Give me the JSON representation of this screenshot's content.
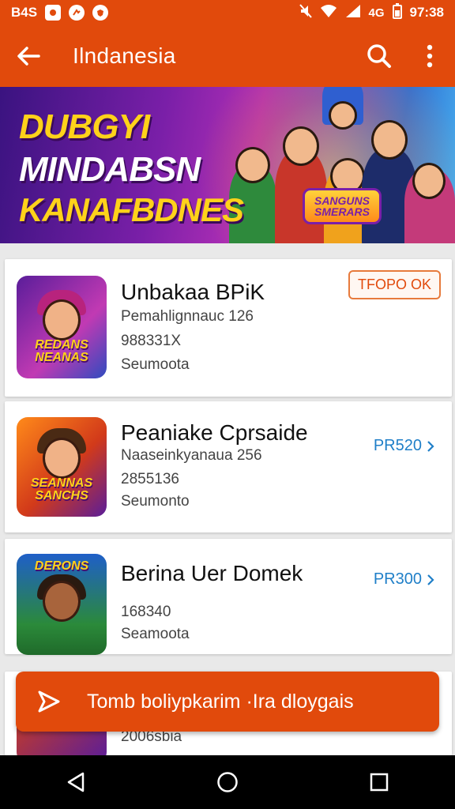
{
  "status_bar": {
    "left_text": "B4S",
    "time": "97:38",
    "left_icons": [
      "image-icon",
      "message-icon",
      "shield-icon"
    ],
    "right_icons": [
      "mute-icon",
      "wifi-icon",
      "signal-icon",
      "data-icon",
      "battery-icon"
    ],
    "data_label": "4G"
  },
  "app_bar": {
    "title": "Ilndanesia",
    "back_icon": "arrow-left-icon",
    "search_icon": "search-icon",
    "more_icon": "more-vert-icon"
  },
  "banner": {
    "line1": "DUBGYI",
    "line2": "MINDABSN",
    "line3": "KANAFBDNES",
    "badge": "SANGUNS SMERARS"
  },
  "items": [
    {
      "title": "Unbakaa BPiK",
      "line1": "Pemahlignnauc 126",
      "line2": "988331X",
      "line3": "Seumoota",
      "tag": "TFOPO OK",
      "price": "",
      "thumb_text": "REDANS NEANAS"
    },
    {
      "title": "Peaniake Cprsaide",
      "line1": "Naaseinkyanaua 256",
      "line2": "2855136",
      "line3": "Seumonto",
      "tag": "",
      "price": "PR520",
      "thumb_text": "SEANNAS SANCHS"
    },
    {
      "title": "Berina Uer Domek",
      "line1": "",
      "line2": "168340",
      "line3": "Seamoota",
      "tag": "",
      "price": "PR300",
      "thumb_text": "DERONS"
    },
    {
      "title": "",
      "line1": "",
      "line2": "2006sbia",
      "line3": "",
      "tag": "",
      "price": "",
      "thumb_text": ""
    }
  ],
  "cta": {
    "label": "Tomb boliypkarim ·Ira dloygais",
    "icon": "send-icon"
  },
  "nav": [
    "back-triangle-icon",
    "home-circle-icon",
    "recents-square-icon"
  ],
  "colors": {
    "primary": "#e14a0c",
    "link": "#1f7fc8",
    "background": "#e9e9e9"
  }
}
